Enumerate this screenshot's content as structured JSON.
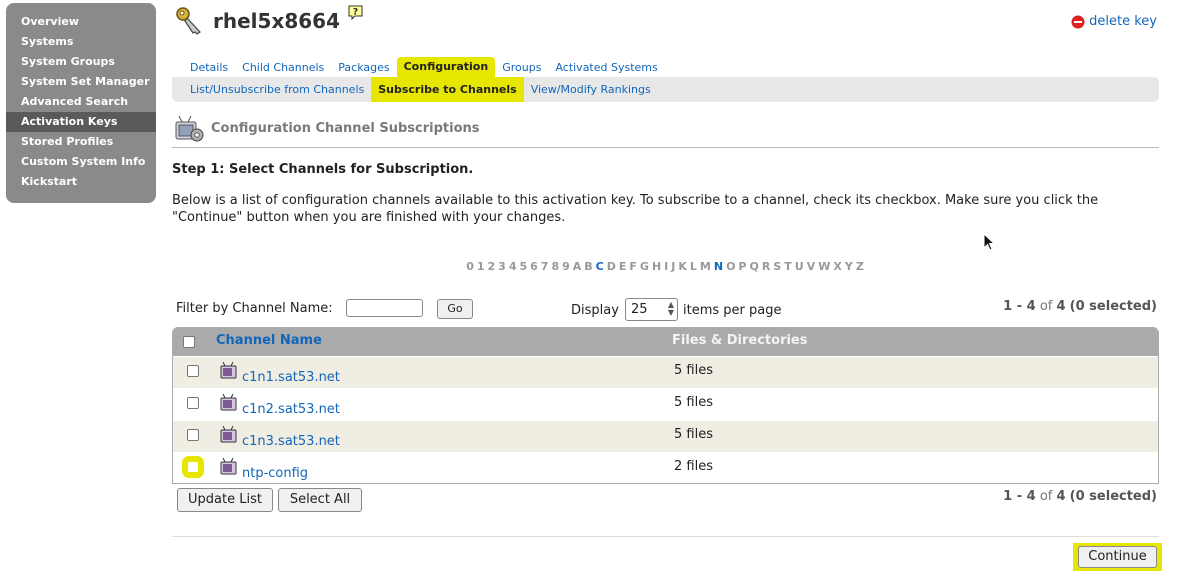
{
  "sidebar": {
    "items": [
      {
        "label": "Overview"
      },
      {
        "label": "Systems"
      },
      {
        "label": "System Groups"
      },
      {
        "label": "System Set Manager"
      },
      {
        "label": "Advanced Search"
      },
      {
        "label": "Activation Keys",
        "active": true
      },
      {
        "label": "Stored Profiles"
      },
      {
        "label": "Custom System Info"
      },
      {
        "label": "Kickstart"
      }
    ]
  },
  "header": {
    "title": "rhel5x8664",
    "delete_label": "delete key"
  },
  "tabs": [
    {
      "label": "Details"
    },
    {
      "label": "Child Channels"
    },
    {
      "label": "Packages"
    },
    {
      "label": "Configuration",
      "active": true
    },
    {
      "label": "Groups"
    },
    {
      "label": "Activated Systems"
    }
  ],
  "subtabs": [
    {
      "label": "List/Unsubscribe from Channels"
    },
    {
      "label": "Subscribe to Channels",
      "active": true
    },
    {
      "label": "View/Modify Rankings"
    }
  ],
  "section": {
    "title": "Configuration Channel Subscriptions",
    "step_title": "Step 1: Select Channels for Subscription.",
    "intro": "Below is a list of configuration channels available to this activation key. To subscribe to a channel, check its checkbox. Make sure you click the \"Continue\" button when you are finished with your changes."
  },
  "alphabar": {
    "letters": [
      "0",
      "1",
      "2",
      "3",
      "4",
      "5",
      "6",
      "7",
      "8",
      "9",
      "A",
      "B",
      "C",
      "D",
      "E",
      "F",
      "G",
      "H",
      "I",
      "J",
      "K",
      "L",
      "M",
      "N",
      "O",
      "P",
      "Q",
      "R",
      "S",
      "T",
      "U",
      "V",
      "W",
      "X",
      "Y",
      "Z"
    ],
    "active": [
      "C",
      "N"
    ]
  },
  "filter": {
    "label": "Filter by Channel Name:",
    "value": "",
    "go_label": "Go"
  },
  "display": {
    "label": "Display",
    "value": "25",
    "suffix": "items per page"
  },
  "pager": {
    "range": "1 - 4",
    "of_label": "of",
    "total": "4",
    "selected": "(0 selected)"
  },
  "table": {
    "headers": {
      "name": "Channel Name",
      "files": "Files & Directories"
    },
    "rows": [
      {
        "name": "c1n1.sat53.net",
        "files": "5 files"
      },
      {
        "name": "c1n2.sat53.net",
        "files": "5 files"
      },
      {
        "name": "c1n3.sat53.net",
        "files": "5 files"
      },
      {
        "name": "ntp-config",
        "files": "2 files"
      }
    ]
  },
  "buttons": {
    "update_list": "Update List",
    "select_all": "Select All",
    "continue": "Continue"
  },
  "colors": {
    "accent": "#e6e600",
    "link": "#1166bb",
    "sidebar": "#8a8a8a"
  }
}
